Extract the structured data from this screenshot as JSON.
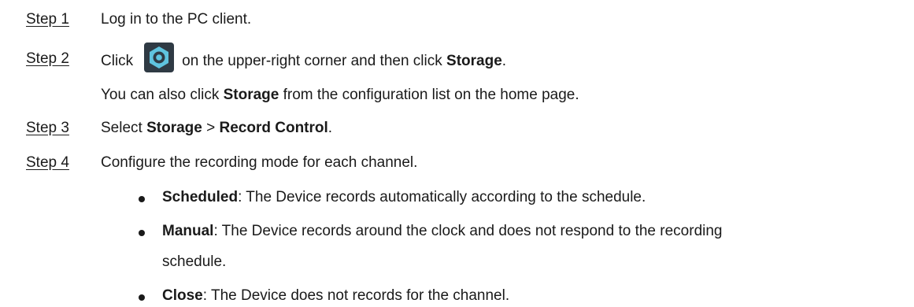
{
  "steps": [
    {
      "label": "Step 1",
      "text": "Log in to the PC client."
    },
    {
      "label": "Step 2",
      "pre": "Click",
      "icon": "settings-gear-icon",
      "mid": "on the upper-right corner and then click ",
      "bold": "Storage",
      "post": ".",
      "note": {
        "pre": "You can also click ",
        "bold": "Storage",
        "post": " from the configuration list on the home page."
      }
    },
    {
      "label": "Step 3",
      "pre": "Select ",
      "bold1": "Storage",
      "sep": " > ",
      "bold2": "Record Control",
      "post": "."
    },
    {
      "label": "Step 4",
      "text": "Configure the recording mode for each channel."
    }
  ],
  "modes": [
    {
      "term": "Scheduled",
      "desc": ": The Device records automatically according to the schedule."
    },
    {
      "term": "Manual",
      "desc": ": The Device records around the clock and does not respond to the recording",
      "desc_cont": "schedule."
    },
    {
      "term": "Close",
      "desc": ": The Device does not records for the channel."
    }
  ],
  "colors": {
    "icon_bg": "#2f3a44",
    "icon_ring": "#5fc3de"
  }
}
